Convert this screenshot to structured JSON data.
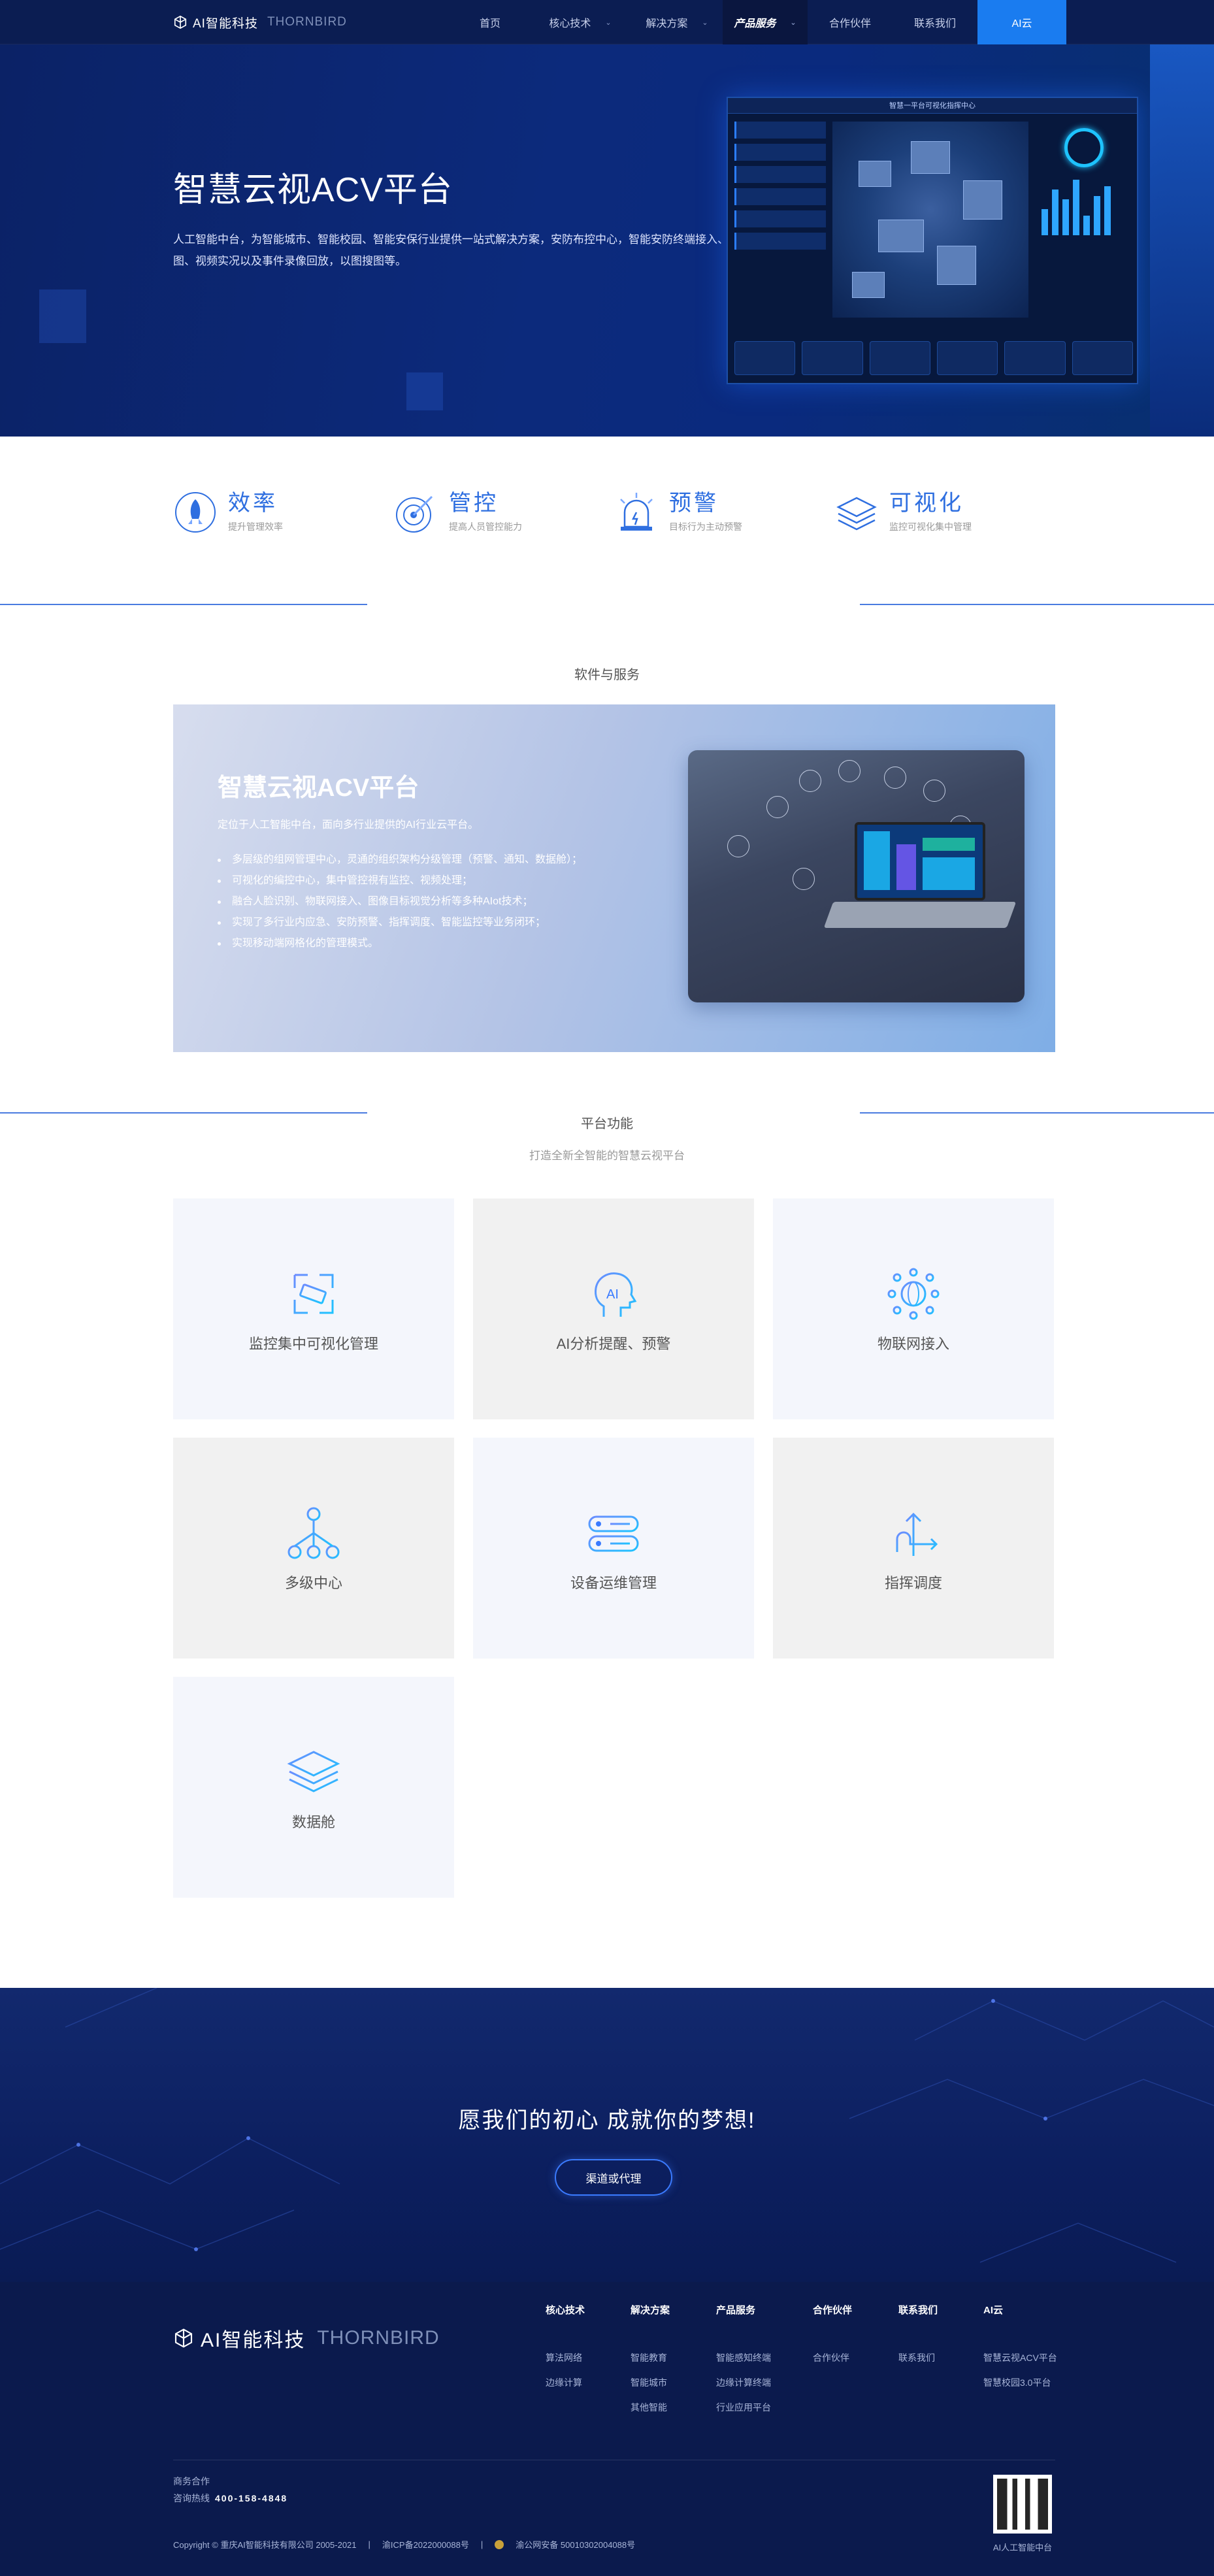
{
  "nav": {
    "logo_cn": "AI智能科技",
    "logo_en": "THORNBIRD",
    "items": [
      {
        "label": "首页",
        "caret": false
      },
      {
        "label": "核心技术",
        "caret": true
      },
      {
        "label": "解决方案",
        "caret": true
      },
      {
        "label": "产品服务",
        "caret": true
      },
      {
        "label": "合作伙伴",
        "caret": false
      },
      {
        "label": "联系我们",
        "caret": false
      },
      {
        "label": "AI云",
        "caret": false
      }
    ],
    "active_index": 3,
    "caret_glyph": "⌄"
  },
  "hero": {
    "title": "智慧云视ACV平台",
    "description": "人工智能中台，为智能城市、智能校园、智能安保行业提供一站式解决方案，安防布控中心，智能安防终端接入、GIS地图、视频实况以及事件录像回放，以图搜图等。",
    "dashboard_title": "智慧一平台可视化指挥中心"
  },
  "features": [
    {
      "title": "效率",
      "subtitle": "提升管理效率",
      "icon": "rocket-icon"
    },
    {
      "title": "管控",
      "subtitle": "提高人员管控能力",
      "icon": "target-icon"
    },
    {
      "title": "预警",
      "subtitle": "目标行为主动预警",
      "icon": "alarm-light-icon"
    },
    {
      "title": "可视化",
      "subtitle": "监控可视化集中管理",
      "icon": "layers-icon"
    }
  ],
  "software": {
    "section_label": "软件与服务",
    "title": "智慧云视ACV平台",
    "intro": "定位于人工智能中台，面向多行业提供的AI行业云平台。",
    "bullets": [
      "多层级的组网管理中心，灵通的组织架构分级管理（预警、通知、数据舱）；",
      "可视化的编控中心，集中管控視有监控、视频处理；",
      "融合人脸识别、物联网接入、图像目标视觉分析等多种AIot技术；",
      "实现了多行业内应急、安防预警、指挥调度、智能监控等业务闭环；",
      "实现移动端网格化的管理模式。"
    ]
  },
  "platform": {
    "section_label": "平台功能",
    "subtitle": "打造全新全智能的智慧云视平台",
    "tiles": [
      {
        "label": "监控集中可视化管理",
        "icon": "monitor-camera-icon"
      },
      {
        "label": "AI分析提醒、预警",
        "icon": "ai-head-icon"
      },
      {
        "label": "物联网接入",
        "icon": "iot-globe-icon"
      },
      {
        "label": "多级中心",
        "icon": "hierarchy-icon"
      },
      {
        "label": "设备运维管理",
        "icon": "server-icon"
      },
      {
        "label": "指挥调度",
        "icon": "dispatch-arrows-icon"
      },
      {
        "label": "数据舱",
        "icon": "data-stack-icon"
      }
    ]
  },
  "banner": {
    "title": "愿我们的初心 成就你的梦想!",
    "button": "渠道或代理"
  },
  "footer": {
    "logo_cn": "AI智能科技",
    "logo_en": "THORNBIRD",
    "columns": [
      {
        "head": "核心技术",
        "links": [
          "算法网络",
          "边缘计算"
        ]
      },
      {
        "head": "解决方案",
        "links": [
          "智能教育",
          "智能城市",
          "其他智能"
        ]
      },
      {
        "head": "产品服务",
        "links": [
          "智能感知终端",
          "边缘计算终端",
          "行业应用平台"
        ]
      },
      {
        "head": "合作伙伴",
        "links": [
          "合作伙伴"
        ]
      },
      {
        "head": "联系我们",
        "links": [
          "联系我们"
        ]
      },
      {
        "head": "AI云",
        "links": [
          "智慧云视ACV平台",
          "智慧校园3.0平台"
        ]
      }
    ],
    "biz_label": "商务合作",
    "phone_label": "咨询热线",
    "phone": "400-158-4848",
    "copyright": "Copyright © 重庆AI智能科技有限公司 2005-2021",
    "icp": "渝ICP备2022000088号",
    "police": "渝公网安备 50010302004088号",
    "qr_caption": "AI人工智能中台"
  },
  "colors": {
    "nav_bg": "#0b1d52",
    "accent": "#1a7cf0",
    "feature_blue": "#2f6fe0",
    "banner_bg": "#0c1f5f",
    "footer_bg": "#0b1a4d"
  }
}
